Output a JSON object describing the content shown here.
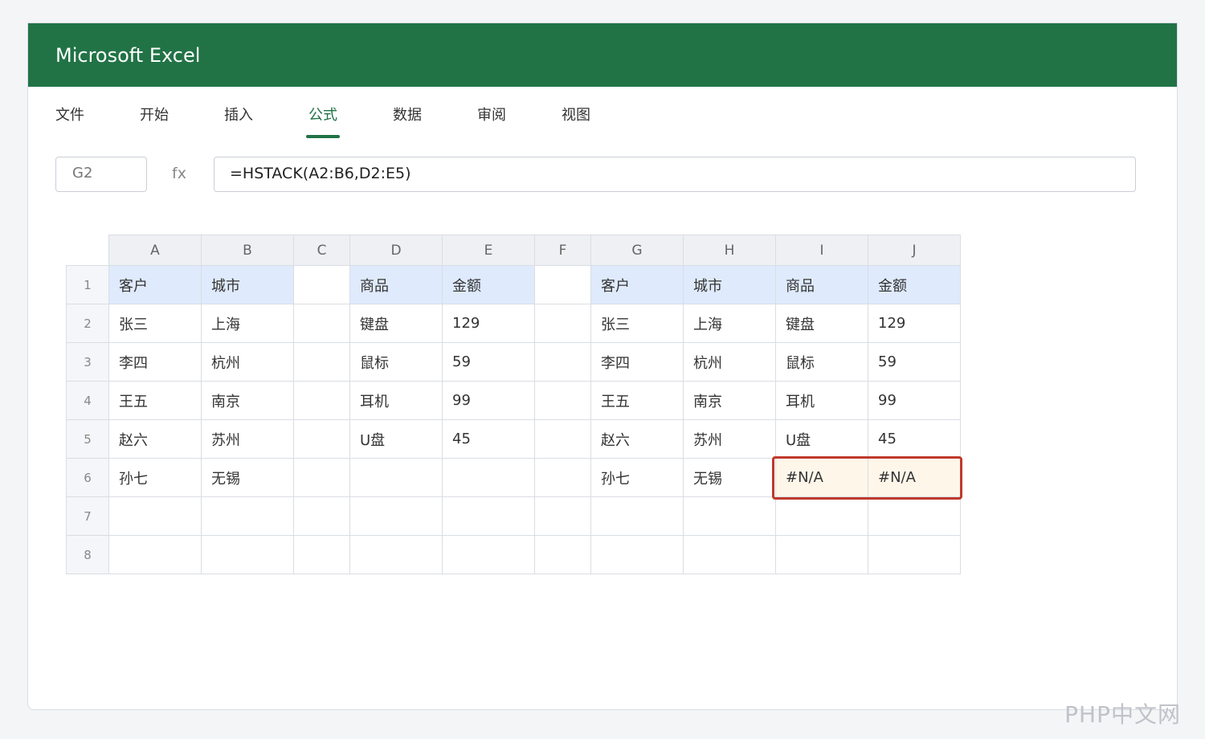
{
  "app": {
    "title": "Microsoft Excel",
    "accent": "#217346"
  },
  "ribbon": {
    "tabs": [
      {
        "label": "文件"
      },
      {
        "label": "开始"
      },
      {
        "label": "插入"
      },
      {
        "label": "公式",
        "active": true
      },
      {
        "label": "数据"
      },
      {
        "label": "审阅"
      },
      {
        "label": "视图"
      }
    ]
  },
  "formula_bar": {
    "name_box": "G2",
    "fx_label": "fx",
    "formula": "=HSTACK(A2:B6,D2:E5)"
  },
  "sheet": {
    "columns": [
      "A",
      "B",
      "C",
      "D",
      "E",
      "F",
      "G",
      "H",
      "I",
      "J"
    ],
    "rows": [
      {
        "num": "1",
        "cells": [
          "客户",
          "城市",
          "",
          "商品",
          "金额",
          "",
          "客户",
          "城市",
          "商品",
          "金额"
        ]
      },
      {
        "num": "2",
        "cells": [
          "张三",
          "上海",
          "",
          "键盘",
          "129",
          "",
          "张三",
          "上海",
          "键盘",
          "129"
        ]
      },
      {
        "num": "3",
        "cells": [
          "李四",
          "杭州",
          "",
          "鼠标",
          "59",
          "",
          "李四",
          "杭州",
          "鼠标",
          "59"
        ]
      },
      {
        "num": "4",
        "cells": [
          "王五",
          "南京",
          "",
          "耳机",
          "99",
          "",
          "王五",
          "南京",
          "耳机",
          "99"
        ]
      },
      {
        "num": "5",
        "cells": [
          "赵六",
          "苏州",
          "",
          "U盘",
          "45",
          "",
          "赵六",
          "苏州",
          "U盘",
          "45"
        ]
      },
      {
        "num": "6",
        "cells": [
          "孙七",
          "无锡",
          "",
          "",
          "",
          "",
          "孙七",
          "无锡",
          "#N/A",
          "#N/A"
        ]
      },
      {
        "num": "7",
        "cells": [
          "",
          "",
          "",
          "",
          "",
          "",
          "",
          "",
          "",
          ""
        ]
      },
      {
        "num": "8",
        "cells": [
          "",
          "",
          "",
          "",
          "",
          "",
          "",
          "",
          "",
          ""
        ]
      }
    ],
    "highlight_color": "#c0392b"
  },
  "watermark": "PHP中文网"
}
